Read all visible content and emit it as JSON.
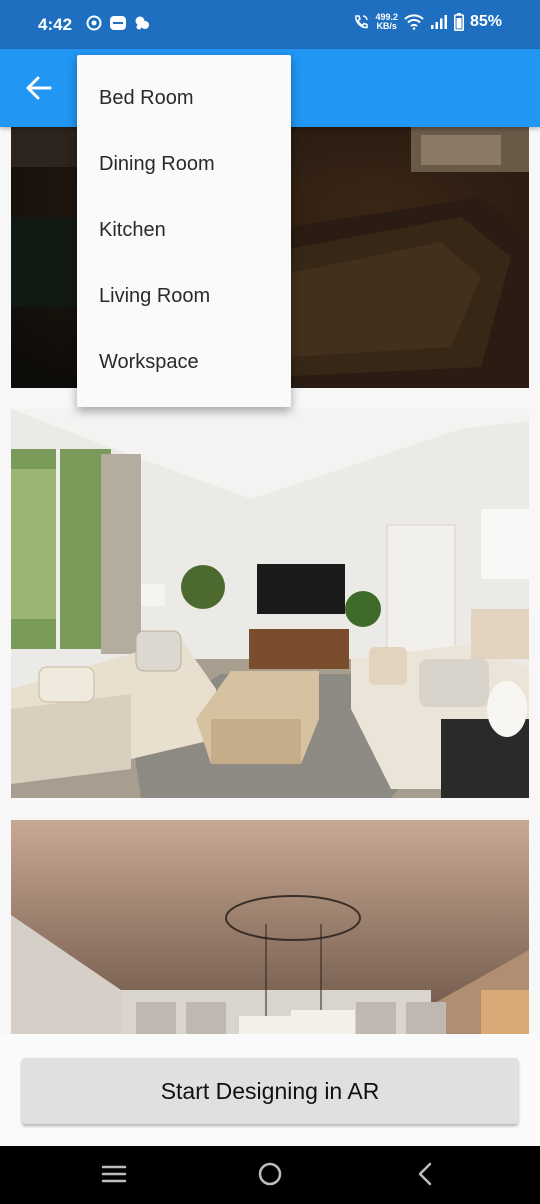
{
  "status_bar": {
    "time": "4:42",
    "net_speed_value": "499.2",
    "net_speed_unit": "KB/s",
    "battery": "85%",
    "icons": [
      "app-notification-icon",
      "app-notification-icon",
      "app-notification-icon",
      "wifi-call-icon",
      "wifi-icon",
      "signal-icon",
      "battery-icon"
    ]
  },
  "app_bar": {
    "back_icon": "arrow-left-icon",
    "color": "#2196f3"
  },
  "room_menu": {
    "items": [
      "Bed Room",
      "Dining Room",
      "Kitchen",
      "Living Room",
      "Workspace"
    ]
  },
  "gallery": {
    "images": [
      "dark-living-room-photo",
      "living-room-photo",
      "dining-room-photo"
    ]
  },
  "action": {
    "label": "Start Designing in AR"
  },
  "nav_bar": {
    "icons": [
      "recents-icon",
      "home-icon",
      "back-icon"
    ]
  }
}
